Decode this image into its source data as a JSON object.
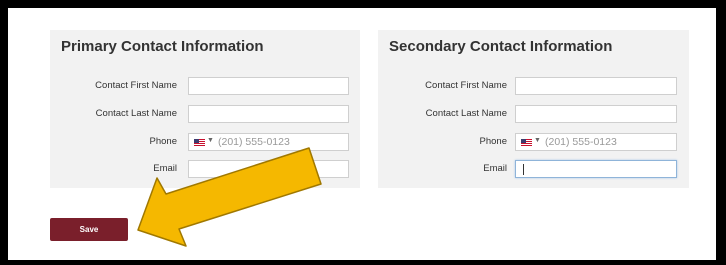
{
  "primary": {
    "title": "Primary Contact Information",
    "first_name_label": "Contact First Name",
    "last_name_label": "Contact Last Name",
    "phone_label": "Phone",
    "phone_placeholder": "(201) 555-0123",
    "email_label": "Email"
  },
  "secondary": {
    "title": "Secondary Contact Information",
    "first_name_label": "Contact First Name",
    "last_name_label": "Contact Last Name",
    "phone_label": "Phone",
    "phone_placeholder": "(201) 555-0123",
    "email_label": "Email"
  },
  "save_label": "Save",
  "colors": {
    "save_button": "#7a1f2b",
    "panel_bg": "#f2f2f2",
    "arrow_fill": "#f5b800",
    "arrow_outline": "#a07800"
  },
  "icons": {
    "country_flag": "us-flag-icon",
    "dropdown": "chevron-down-icon",
    "annotation": "arrow-annotation"
  }
}
